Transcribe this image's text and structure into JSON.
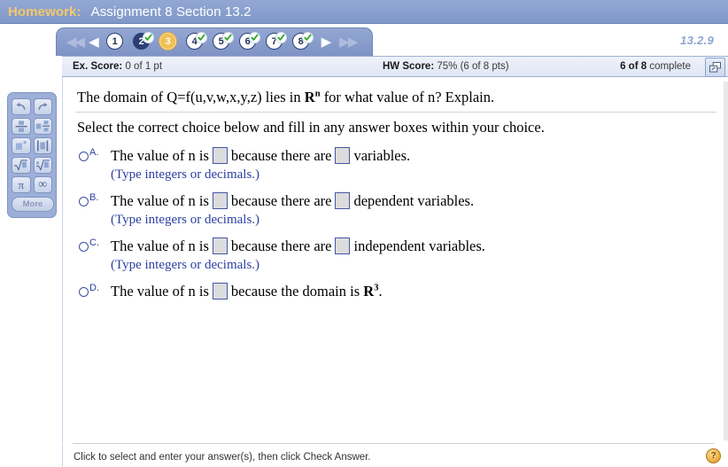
{
  "header": {
    "label": "Homework:",
    "title": "Assignment 8 Section 13.2"
  },
  "exercise_id": "13.2.9",
  "nav": {
    "first_icon": "double-left-arrow",
    "prev_icon": "left-arrow",
    "next_icon": "right-arrow",
    "last_icon": "double-right-arrow",
    "questions": [
      {
        "number": "1",
        "state": "unanswered",
        "checked": false
      },
      {
        "number": "2",
        "state": "filled",
        "checked": true
      },
      {
        "number": "3",
        "state": "current",
        "checked": false
      },
      {
        "number": "4",
        "state": "unanswered",
        "checked": true
      },
      {
        "number": "5",
        "state": "unanswered",
        "checked": true
      },
      {
        "number": "6",
        "state": "unanswered",
        "checked": true
      },
      {
        "number": "7",
        "state": "unanswered",
        "checked": true
      },
      {
        "number": "8",
        "state": "unanswered",
        "checked": true
      }
    ]
  },
  "score": {
    "ex_label": "Ex. Score:",
    "ex_value": "0 of 1 pt",
    "hw_label": "HW Score:",
    "hw_value": "75% (6 of 8 pts)",
    "complete_value": "6 of 8",
    "complete_label": "complete",
    "popout_icon": "pop-out-window-icon"
  },
  "question": {
    "stem_part1": "The domain of Q",
    "stem_eq": "=",
    "stem_part2": "f(u,v,w,x,y,z) lies in",
    "stem_r": "R",
    "stem_exp": "n",
    "stem_part3": "for what value of n? Explain.",
    "prompt": "Select the correct choice below and fill in any answer boxes within your choice.",
    "hint_text": "(Type integers or decimals.)",
    "choices": [
      {
        "letter": "A.",
        "text_1": "The value of n is",
        "text_2": "because there are",
        "text_3": "variables.",
        "boxes": 2,
        "hint": "(Type integers or decimals.)"
      },
      {
        "letter": "B.",
        "text_1": "The value of n is",
        "text_2": "because there are",
        "text_3": "dependent variables.",
        "boxes": 2,
        "hint": "(Type integers or decimals.)"
      },
      {
        "letter": "C.",
        "text_1": "The value of n is",
        "text_2": "because there are",
        "text_3": "independent variables.",
        "boxes": 2,
        "hint": "(Type integers or decimals.)"
      },
      {
        "letter": "D.",
        "text_1": "The value of n is",
        "text_2": "because the domain is",
        "text_r": "R",
        "text_exp": "3",
        "text_end": ".",
        "boxes": 1,
        "hint": ""
      }
    ]
  },
  "footer": {
    "message": "Click to select and enter your answer(s), then click Check Answer.",
    "help_icon": "help-question-icon",
    "help_glyph": "?"
  },
  "palette": {
    "more_label": "More",
    "buttons": [
      {
        "name": "undo-icon",
        "glyph": "↶"
      },
      {
        "name": "redo-icon",
        "glyph": "↷"
      },
      {
        "name": "fraction-icon",
        "glyph": ""
      },
      {
        "name": "mixed-number-icon",
        "glyph": ""
      },
      {
        "name": "exponent-icon",
        "glyph": ""
      },
      {
        "name": "absolute-value-icon",
        "glyph": ""
      },
      {
        "name": "square-root-icon",
        "glyph": "√"
      },
      {
        "name": "nth-root-icon",
        "glyph": "√"
      },
      {
        "name": "pi-icon",
        "glyph": "π"
      },
      {
        "name": "infinity-icon",
        "glyph": "∞"
      }
    ]
  },
  "colors": {
    "header_bg": "#8ba0cf",
    "header_label": "#f5c869",
    "accent_blue": "#2b3fa0",
    "current_gold": "#f2bf52",
    "check_green": "#2faa2f"
  }
}
